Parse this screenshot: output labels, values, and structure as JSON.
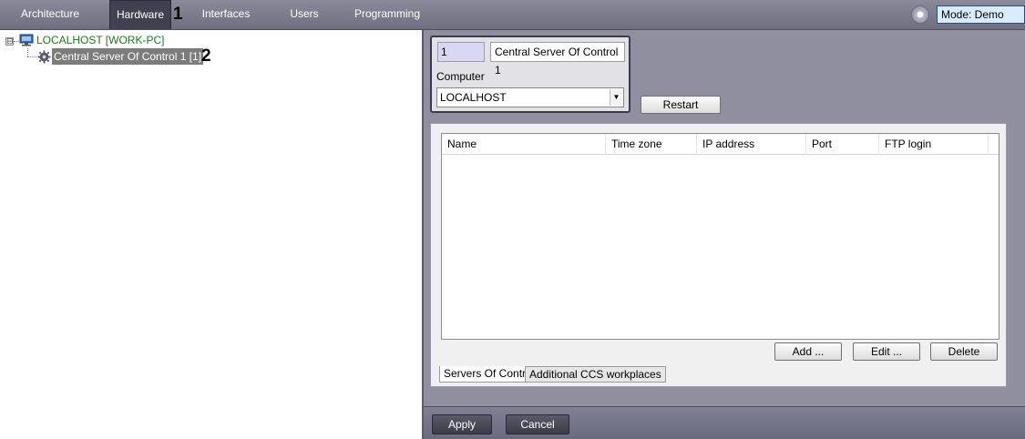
{
  "nav": {
    "tabs": [
      "Architecture",
      "Hardware",
      "Interfaces",
      "Users",
      "Programming"
    ],
    "active": "Hardware",
    "mode_label": "Mode: Demo"
  },
  "callouts": [
    "1",
    "2"
  ],
  "tree": {
    "expander": "⊟",
    "host": "LOCALHOST [WORK-PC]",
    "child": "Central Server Of Control 1 [1]"
  },
  "object": {
    "id": "1",
    "name": "Central Server Of Control 1",
    "computer_label": "Computer",
    "computer_value": "LOCALHOST",
    "restart_label": "Restart"
  },
  "table": {
    "columns": [
      "Name",
      "Time zone",
      "IP address",
      "Port",
      "FTP login"
    ],
    "rows": []
  },
  "actions": {
    "add": "Add ...",
    "edit": "Edit ...",
    "delete": "Delete"
  },
  "bottom_tabs": [
    "Servers Of Control",
    "Additional CCS workplaces"
  ],
  "footer": {
    "apply": "Apply",
    "cancel": "Cancel"
  },
  "colors": {
    "host_text": "#1a7a1a",
    "selected_node_bg": "#7c7c7c",
    "nav_active_bg": "#3f4150"
  }
}
